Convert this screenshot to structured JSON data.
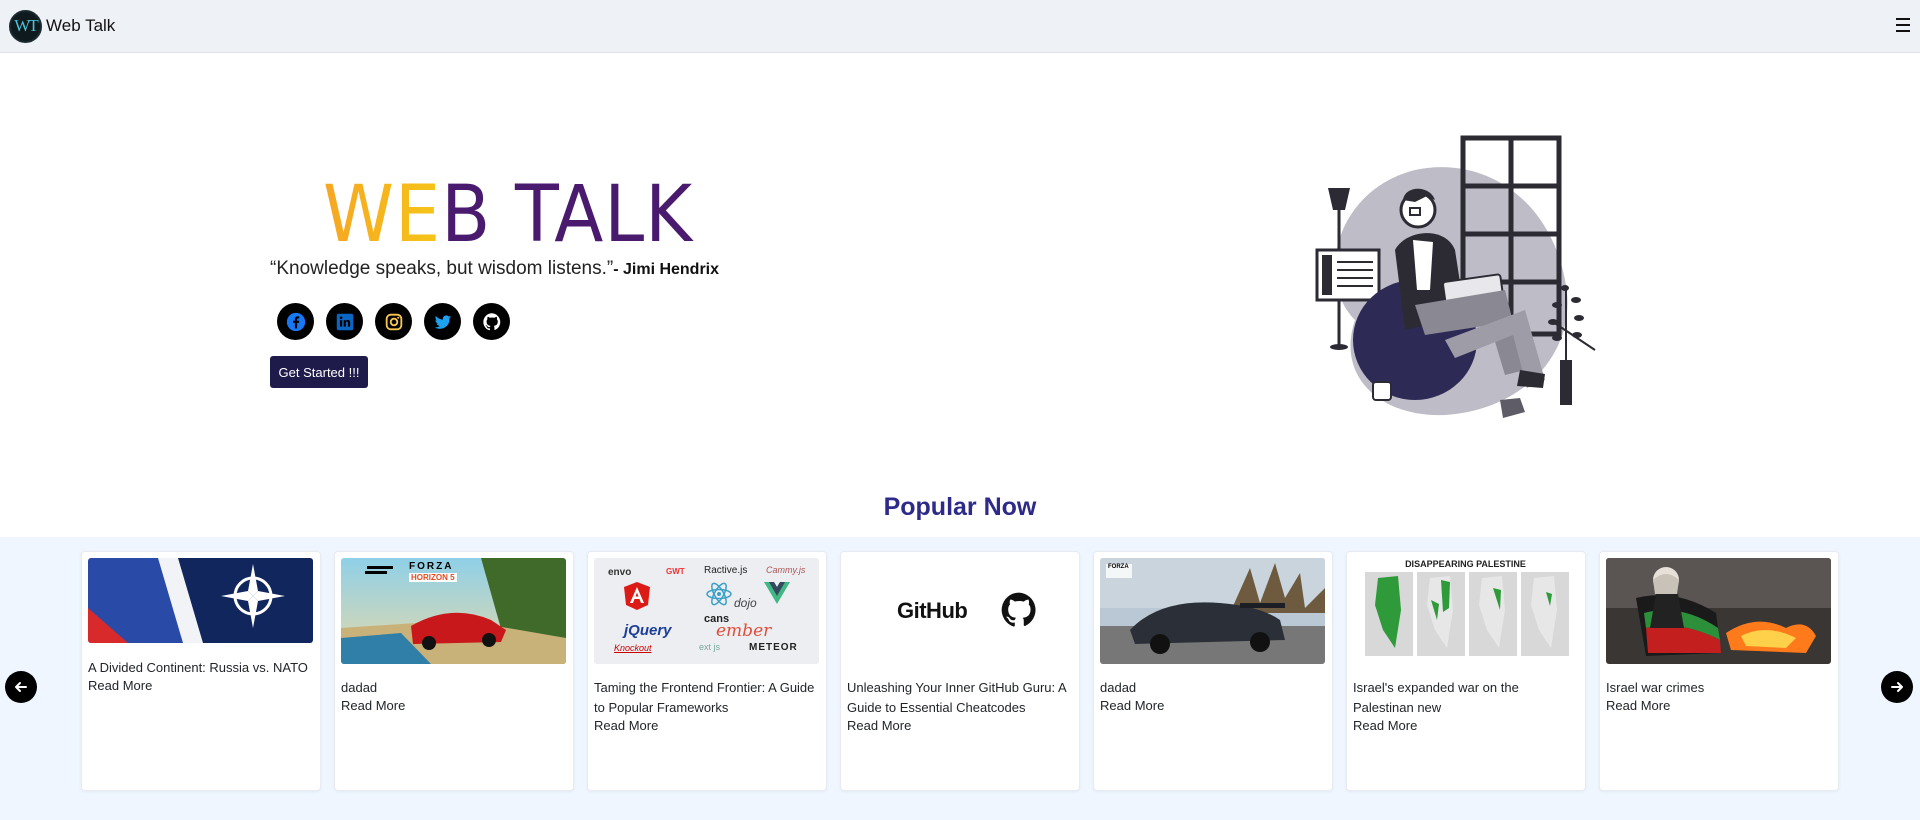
{
  "navbar": {
    "logo_text": "WT",
    "brand": "Web Talk"
  },
  "hero": {
    "title_gradient": "WE",
    "title_rest": "B TALK",
    "quote": "“Knowledge speaks, but wisdom listens.”",
    "author": "- Jimi Hendrix",
    "cta_label": "Get Started !!!",
    "socials": [
      {
        "icon": "facebook-icon",
        "color": "#1877f2"
      },
      {
        "icon": "linkedin-icon",
        "color": "#0a66c2"
      },
      {
        "icon": "instagram-icon",
        "color": "#f9c74f"
      },
      {
        "icon": "twitter-icon",
        "color": "#1da1f2"
      },
      {
        "icon": "github-icon",
        "color": "#ffffff"
      }
    ]
  },
  "popular": {
    "heading": "Popular Now",
    "read_more": "Read More",
    "cards": [
      {
        "title": "A Divided Continent: Russia vs. NATO",
        "image": "nato-flag-image"
      },
      {
        "title": "dadad",
        "image": "forza-horizon-5-image"
      },
      {
        "title": "Taming the Frontend Frontier: A Guide to Popular Frameworks",
        "image": "frontend-frameworks-logos-image",
        "logos": [
          "envo",
          "GWT",
          "Ractive.js",
          "Cammy.js",
          "dojo",
          "cans",
          "jQuery",
          "ember",
          "Knockout",
          "ext js",
          "METEOR"
        ]
      },
      {
        "title": "Unleashing Your Inner GitHub Guru: A Guide to Essential Cheatcodes",
        "image": "github-logo-image",
        "logo_text": "GitHub"
      },
      {
        "title": "dadad",
        "image": "forza-car-image",
        "logo_text": "FORZA"
      },
      {
        "title": "Israel's expanded war on the Palestinan new",
        "image": "disappearing-palestine-map-image",
        "map_heading": "DISAPPEARING PALESTINE"
      },
      {
        "title": "Israel war crimes",
        "image": "protester-flag-image"
      }
    ],
    "forza_logo": [
      "FORZA",
      "HORIZON 5"
    ]
  },
  "colors": {
    "accent": "#1e1b4b",
    "heading": "#2d2a8a",
    "title_purple": "#4a1a6e",
    "strip_bg": "#eff6ff"
  }
}
